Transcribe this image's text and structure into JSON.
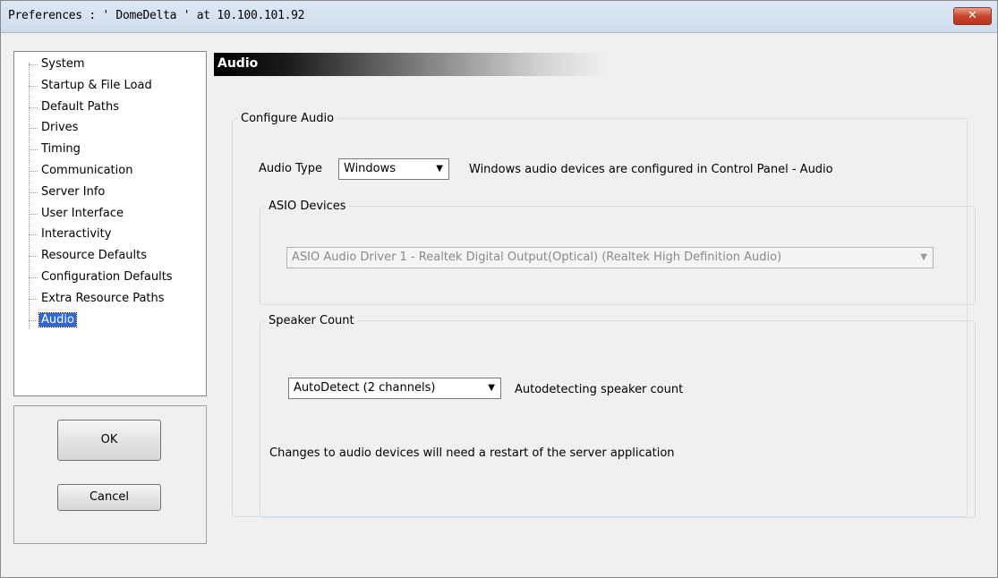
{
  "window": {
    "title": "Preferences  :  ' DomeDelta ' at  10.100.101.92",
    "close_glyph": "✕"
  },
  "sidebar": {
    "items": [
      {
        "label": "System"
      },
      {
        "label": "Startup & File Load"
      },
      {
        "label": "Default Paths"
      },
      {
        "label": "Drives"
      },
      {
        "label": "Timing"
      },
      {
        "label": "Communication"
      },
      {
        "label": "Server Info"
      },
      {
        "label": "User Interface"
      },
      {
        "label": "Interactivity"
      },
      {
        "label": "Resource Defaults"
      },
      {
        "label": "Configuration Defaults"
      },
      {
        "label": "Extra Resource Paths"
      },
      {
        "label": "Audio"
      }
    ],
    "selected": "Audio"
  },
  "buttons": {
    "ok_label": "OK",
    "cancel_label": "Cancel"
  },
  "panel": {
    "header": "Audio",
    "configure_group": "Configure Audio",
    "audio_type_label": "Audio Type",
    "audio_type_value": "Windows",
    "audio_type_note": "Windows audio devices are configured in Control Panel - Audio",
    "asio_group": "ASIO Devices",
    "asio_device_value": "ASIO Audio Driver 1 - Realtek Digital Output(Optical) (Realtek High Definition Audio)",
    "speaker_group": "Speaker Count",
    "speaker_value": "AutoDetect (2 channels)",
    "speaker_note": "Autodetecting speaker count",
    "restart_note": "Changes to audio devices will need a restart of the server application"
  },
  "icons": {
    "dropdown_arrow": "▼"
  }
}
